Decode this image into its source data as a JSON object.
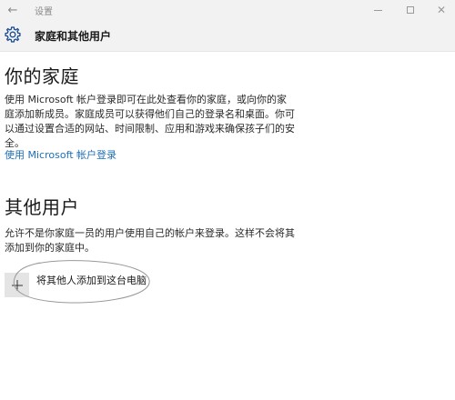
{
  "window": {
    "back_glyph": "←",
    "title": "设置",
    "min_glyph": "",
    "close_glyph": "✕"
  },
  "header": {
    "icon": "gear-icon",
    "title": "家庭和其他用户"
  },
  "family": {
    "heading": "你的家庭",
    "description": "使用 Microsoft 帐户登录即可在此处查看你的家庭，或向你的家庭添加新成员。家庭成员可以获得他们自己的登录名和桌面。你可以通过设置合适的网站、时间限制、应用和游戏来确保孩子们的安全。",
    "link_label": "使用 Microsoft 帐户登录"
  },
  "other_users": {
    "heading": "其他用户",
    "description": "允许不是你家庭一员的用户使用自己的帐户来登录。这样不会将其添加到你的家庭中。",
    "add_icon": "plus-icon",
    "add_label": "将其他人添加到这台电脑"
  },
  "colors": {
    "accent_link": "#1f6fb5",
    "chrome_bg": "#f2f2f2",
    "add_tile_bg": "#e4e4e4"
  }
}
